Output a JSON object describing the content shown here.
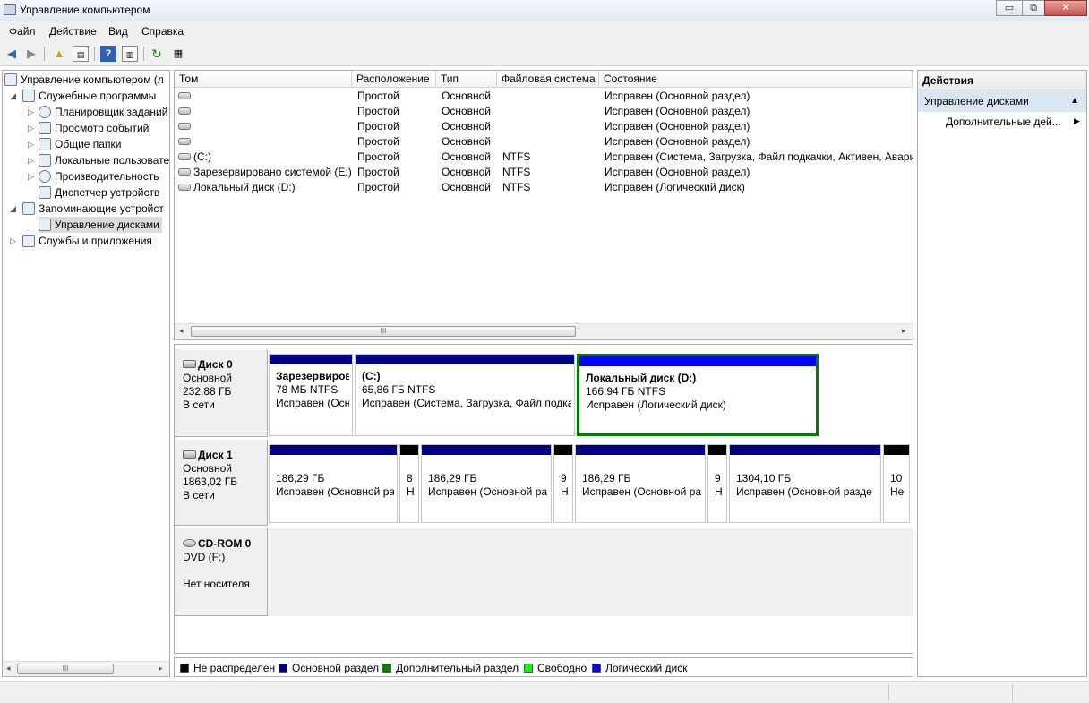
{
  "window": {
    "title": "Управление компьютером",
    "minimize": "▭",
    "restore": "⧉",
    "close": "✕"
  },
  "menu": [
    "Файл",
    "Действие",
    "Вид",
    "Справка"
  ],
  "toolbar": {
    "icons": [
      "back-arrow-icon",
      "forward-arrow-icon",
      "up-folder-icon",
      "show-hide-tree-icon",
      "help-icon",
      "show-hide-action-pane-icon",
      "refresh-icon",
      "properties-icon"
    ]
  },
  "tree": {
    "items": [
      {
        "label": "Управление компьютером (л",
        "expander": ""
      },
      {
        "label": "Служебные программы",
        "expander": "◢"
      },
      {
        "label": "Планировщик заданий",
        "expander": "▷"
      },
      {
        "label": "Просмотр событий",
        "expander": "▷"
      },
      {
        "label": "Общие папки",
        "expander": "▷"
      },
      {
        "label": "Локальные пользовате",
        "expander": "▷"
      },
      {
        "label": "Производительность",
        "expander": "▷"
      },
      {
        "label": "Диспетчер устройств",
        "expander": ""
      },
      {
        "label": "Запоминающие устройст",
        "expander": "◢"
      },
      {
        "label": "Управление дисками",
        "expander": ""
      },
      {
        "label": "Службы и приложения",
        "expander": "▷"
      }
    ],
    "scroll_left": "◂",
    "scroll_right": "▸",
    "scroll_thumb": "III"
  },
  "volumes": {
    "columns": [
      "Том",
      "Расположение",
      "Тип",
      "Файловая система",
      "Состояние"
    ],
    "rows": [
      [
        "",
        "Простой",
        "Основной",
        "",
        "Исправен (Основной раздел)"
      ],
      [
        "",
        "Простой",
        "Основной",
        "",
        "Исправен (Основной раздел)"
      ],
      [
        "",
        "Простой",
        "Основной",
        "",
        "Исправен (Основной раздел)"
      ],
      [
        "",
        "Простой",
        "Основной",
        "",
        "Исправен (Основной раздел)"
      ],
      [
        "(C:)",
        "Простой",
        "Основной",
        "NTFS",
        "Исправен (Система, Загрузка, Файл подкачки, Активен, Авари"
      ],
      [
        "Зарезервировано системой (E:)",
        "Простой",
        "Основной",
        "NTFS",
        "Исправен (Основной раздел)"
      ],
      [
        "Локальный диск (D:)",
        "Простой",
        "Основной",
        "NTFS",
        "Исправен (Логический диск)"
      ]
    ],
    "scroll_left": "◂",
    "scroll_right": "▸",
    "scroll_thumb": "III"
  },
  "disks": [
    {
      "name": "Диск 0",
      "type": "Основной",
      "size": "232,88 ГБ",
      "status": "В сети",
      "partitions": [
        {
          "name": "Зарезервиров",
          "size": "78 МБ NTFS",
          "status": "Исправен (Осн",
          "kind": "primary"
        },
        {
          "name": "(C:)",
          "size": "65,86 ГБ NTFS",
          "status": "Исправен (Система, Загрузка, Файл подка",
          "kind": "primary"
        },
        {
          "name": "Локальный диск  (D:)",
          "size": "166,94 ГБ NTFS",
          "status": "Исправен (Логический диск)",
          "kind": "logical"
        }
      ]
    },
    {
      "name": "Диск 1",
      "type": "Основной",
      "size": "1863,02 ГБ",
      "status": "В сети",
      "partitions": [
        {
          "name": "",
          "size": "186,29 ГБ",
          "status": "Исправен (Основной ра",
          "kind": "primary"
        },
        {
          "name": "",
          "size": "8",
          "status": "Н",
          "kind": "unallocated"
        },
        {
          "name": "",
          "size": "186,29 ГБ",
          "status": "Исправен (Основной ра",
          "kind": "primary"
        },
        {
          "name": "",
          "size": "9",
          "status": "Н",
          "kind": "unallocated"
        },
        {
          "name": "",
          "size": "186,29 ГБ",
          "status": "Исправен (Основной ра",
          "kind": "primary"
        },
        {
          "name": "",
          "size": "9",
          "status": "Н",
          "kind": "unallocated"
        },
        {
          "name": "",
          "size": "1304,10 ГБ",
          "status": "Исправен (Основной разде",
          "kind": "primary"
        },
        {
          "name": "",
          "size": "10",
          "status": "Не",
          "kind": "unallocated"
        }
      ]
    },
    {
      "name": "CD-ROM 0",
      "type": "DVD (F:)",
      "size": "",
      "status": "Нет носителя",
      "partitions": []
    }
  ],
  "legend": [
    {
      "label": "Не распределен",
      "color": "#000000"
    },
    {
      "label": "Основной раздел",
      "color": "#000080"
    },
    {
      "label": "Дополнительный раздел",
      "color": "#008000"
    },
    {
      "label": "Свободно",
      "color": "#00ff00"
    },
    {
      "label": "Логический диск",
      "color": "#0000ff"
    }
  ],
  "colors": {
    "primary": "#000080",
    "logical": "#0000ff",
    "unallocated": "#000000",
    "selected_border": "#008000"
  },
  "actions": {
    "header": "Действия",
    "section": "Управление дисками",
    "section_toggle": "▲",
    "item": "Дополнительные дей...",
    "item_arrow": "▶"
  }
}
